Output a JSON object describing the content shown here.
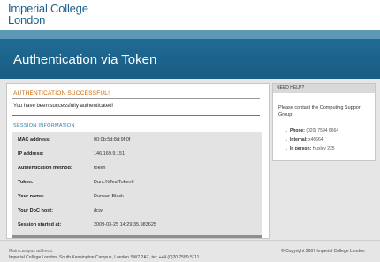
{
  "header": {
    "logo_line1": "Imperial College",
    "logo_line2": "London",
    "title": "Authentication via Token"
  },
  "main": {
    "success_title": "Authentication successful!",
    "success_message": "You have been successfully authenticated!",
    "session_title": "Session information",
    "rows": [
      {
        "label": "MAC address:",
        "value": "00:0b:5d:8d:9f:0f"
      },
      {
        "label": "IP address:",
        "value": "146.169.9.151"
      },
      {
        "label": "Authentication method:",
        "value": "token"
      },
      {
        "label": "Token:",
        "value": "Dunc%TestToken6"
      },
      {
        "label": "Your name:",
        "value": "Duncan Black"
      },
      {
        "label": "Your DoC host:",
        "value": "dcw"
      },
      {
        "label": "Session started at:",
        "value": "2009-03-25 14:29:35.983625"
      }
    ]
  },
  "sidebar": {
    "header": "Need help?",
    "intro": "Please contact the Computing Support Group:",
    "contacts": [
      {
        "label": "Phone:",
        "value": "(020) 7594 6664"
      },
      {
        "label": "Internal:",
        "value": "x46664"
      },
      {
        "label": "In person:",
        "value": "Huxley 225"
      }
    ]
  },
  "footer": {
    "address_label": "Main campus address:",
    "address": "Imperial College London, South Kensington Campus, London SW7 2AZ, tel: +44 (0)20 7589 5111",
    "copyright": "© Copyright 2007 Imperial College London"
  },
  "colors": {
    "brand_blue": "#1a5f8c",
    "success_orange": "#cc6600",
    "section_blue": "#2f7aa6"
  }
}
